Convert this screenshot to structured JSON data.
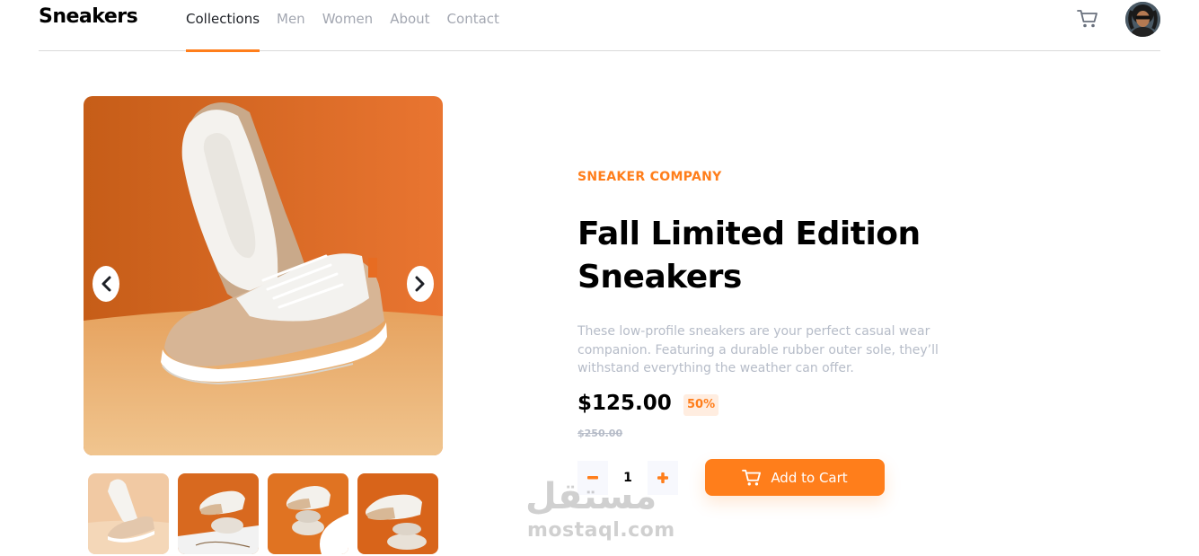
{
  "brand": {
    "logo": "Sneakers",
    "accent_color": "#ff7e1b"
  },
  "nav": {
    "items": [
      {
        "label": "Collections",
        "active": true
      },
      {
        "label": "Men",
        "active": false
      },
      {
        "label": "Women",
        "active": false
      },
      {
        "label": "About",
        "active": false
      },
      {
        "label": "Contact",
        "active": false
      }
    ]
  },
  "header_icons": {
    "cart": "cart-icon",
    "avatar": "user-avatar"
  },
  "gallery": {
    "main_image": "product-image-1",
    "prev_icon": "chevron-left-icon",
    "next_icon": "chevron-right-icon",
    "thumbnails": [
      "product-thumbnail-1",
      "product-thumbnail-2",
      "product-thumbnail-3",
      "product-thumbnail-4"
    ]
  },
  "product": {
    "company": "SNEAKER COMPANY",
    "title": "Fall Limited Edition Sneakers",
    "description": "These low-profile sneakers are your perfect casual wear companion. Featuring a durable rubber outer sole, they’ll withstand everything the weather can offer.",
    "price": "$125.00",
    "discount": "50%",
    "original_price": "$250.00"
  },
  "cart_controls": {
    "quantity": "1",
    "minus_icon": "minus-icon",
    "plus_icon": "plus-icon",
    "add_label": "Add to Cart"
  },
  "watermark": {
    "arabic": "مستقل",
    "latin": "mostaql.com"
  }
}
